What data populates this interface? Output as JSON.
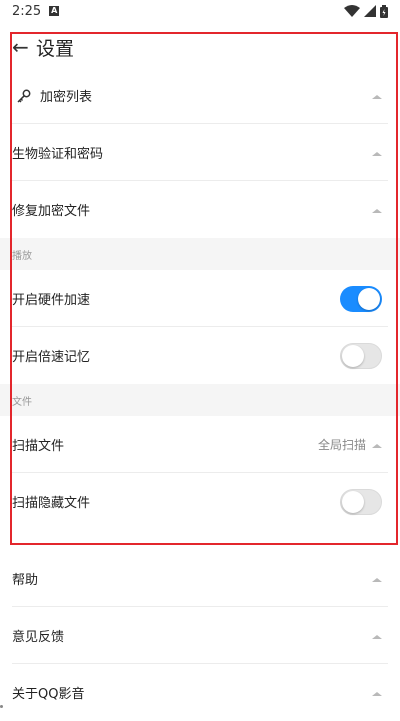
{
  "status_bar": {
    "time": "2:25",
    "notif_badge": "A"
  },
  "header": {
    "back_symbol": "←",
    "title": "设置"
  },
  "security_rows": [
    {
      "label": "加密列表"
    },
    {
      "label": "生物验证和密码"
    },
    {
      "label": "修复加密文件"
    }
  ],
  "sections": {
    "playback": {
      "title": "播放",
      "rows": [
        {
          "label": "开启硬件加速",
          "toggle": true
        },
        {
          "label": "开启倍速记忆",
          "toggle": false
        }
      ]
    },
    "files": {
      "title": "文件",
      "rows": [
        {
          "label": "扫描文件",
          "value": "全局扫描"
        },
        {
          "label": "扫描隐藏文件",
          "toggle": false
        }
      ]
    }
  },
  "bottom_rows": [
    {
      "label": "帮助"
    },
    {
      "label": "意见反馈"
    },
    {
      "label": "关于QQ影音"
    }
  ],
  "colors": {
    "toggle_on": "#1a8cff",
    "highlight_border": "#e3262c"
  }
}
